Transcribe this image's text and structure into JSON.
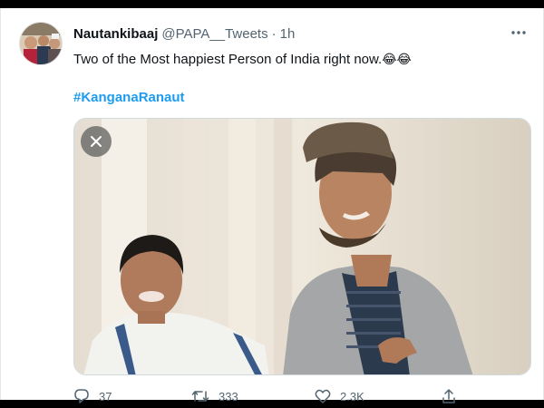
{
  "tweet": {
    "display_name": "Nautankibaaj",
    "handle": "@PAPA__Tweets",
    "separator": "·",
    "time": "1h",
    "text": "Two of the Most happiest Person of India right now.",
    "emojis": "😂😂",
    "hashtag": "#KanganaRanaut"
  },
  "actions": {
    "replies": "37",
    "retweets": "333",
    "likes": "2.3K"
  },
  "icons": {
    "more": "more-icon",
    "close": "close-icon",
    "reply": "reply-icon",
    "retweet": "retweet-icon",
    "like": "like-icon",
    "share": "share-icon"
  },
  "colors": {
    "accent": "#1d9bf0",
    "secondary_text": "#536471"
  }
}
